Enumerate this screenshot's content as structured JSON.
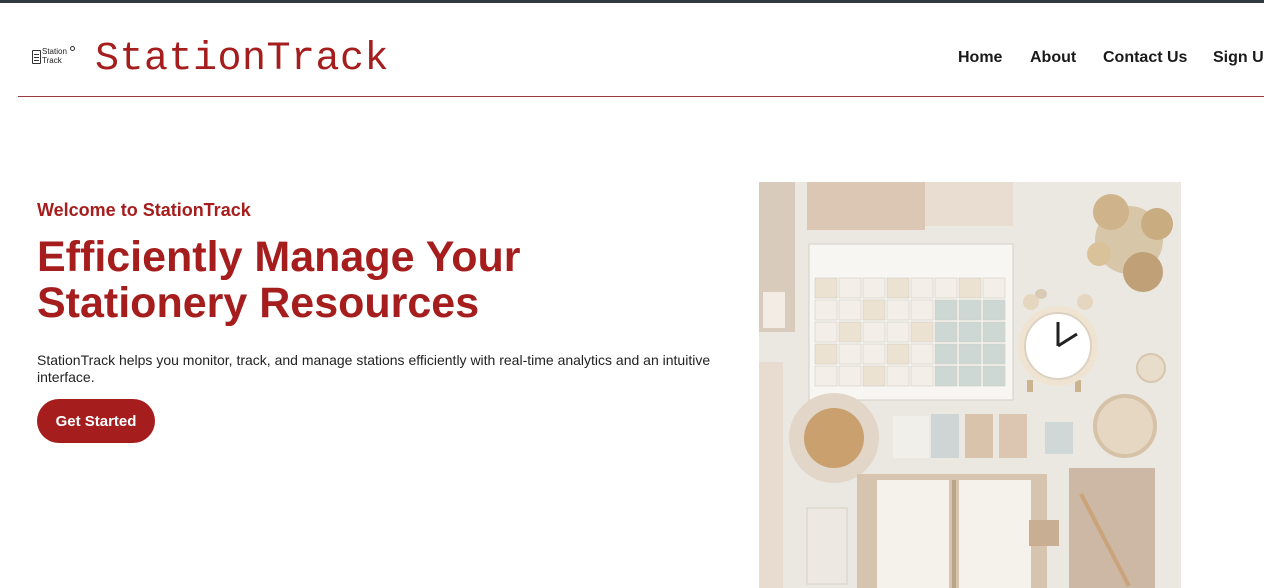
{
  "header": {
    "logo_text": "Station Track",
    "brand": "StationTrack"
  },
  "nav": {
    "home": "Home",
    "about": "About",
    "contact": "Contact Us",
    "signup": "Sign Up"
  },
  "hero": {
    "welcome": "Welcome to StationTrack",
    "headline_line1": "Efficiently Manage Your",
    "headline_line2": "Stationery Resources",
    "description": "StationTrack helps you monitor, track, and manage stations efficiently with real-time analytics and an intuitive interface.",
    "cta_label": "Get Started"
  },
  "colors": {
    "brand": "#a51d1d",
    "text": "#1a1a1a",
    "background": "#ffffff"
  }
}
